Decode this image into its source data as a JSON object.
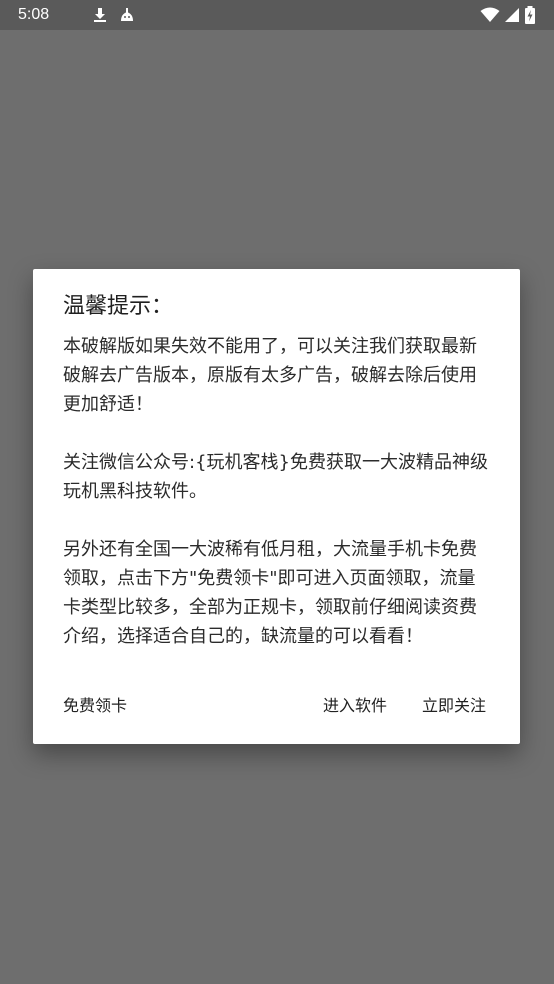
{
  "status_bar": {
    "time": "5:08",
    "icons": [
      "download-icon",
      "android-icon",
      "wifi-icon",
      "signal-icon",
      "battery-charging-icon"
    ]
  },
  "dialog": {
    "title": "温馨提示：",
    "message": "本破解版如果失效不能用了，可以关注我们获取最新破解去广告版本，原版有太多广告，破解去除后使用更加舒适！\n\n关注微信公众号:{玩机客栈}免费获取一大波精品神级玩机黑科技软件。\n\n另外还有全国一大波稀有低月租，大流量手机卡免费领取，点击下方\"免费领卡\"即可进入页面领取，流量卡类型比较多，全部为正规卡，领取前仔细阅读资费介绍，选择适合自己的，缺流量的可以看看！",
    "buttons": {
      "neutral": "免费领卡",
      "negative": "进入软件",
      "positive": "立即关注"
    }
  }
}
